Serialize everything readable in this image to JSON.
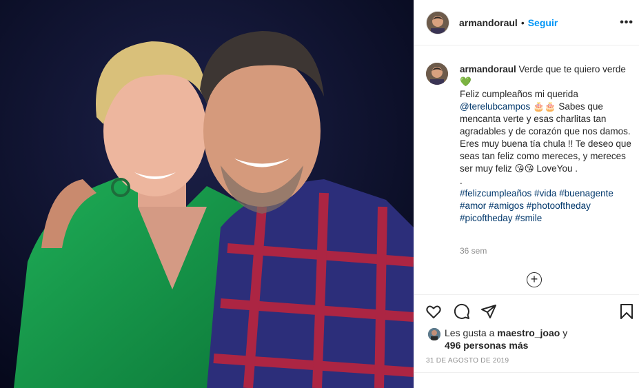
{
  "post": {
    "username": "armandoraul",
    "separator": "•",
    "follow_label": "Seguir",
    "more_icon": "•••"
  },
  "caption": {
    "username": "armandoraul",
    "line1": " Verde que te quiero verde 💚",
    "line2": "Feliz cumpleaños mi querida",
    "mention": "@terelubcampos",
    "line3": " 🎂🎂 Sabes que mencanta verte y esas charlitas tan agradables y de corazón que nos damos. Eres muy buena tía chula !! Te deseo que seas tan feliz como mereces, y mereces ser muy feliz 😘😘 LoveYou .",
    "line4": ".",
    "hashtags": "#felizcumpleaños #vida #buenagente #amor #amigos #photooftheday #picoftheday #smile",
    "time_ago": "36 sem"
  },
  "load_more_label": "+",
  "likes": {
    "prefix": "Les gusta a ",
    "user": "maestro_joao",
    "suffix": " y",
    "others": "496 personas más"
  },
  "date": "31 DE AGOSTO DE 2019",
  "icons": {
    "like": "heart-icon",
    "comment": "comment-icon",
    "share": "share-icon",
    "save": "bookmark-icon"
  },
  "colors": {
    "link_blue": "#0095f6",
    "hashtag": "#00376b",
    "muted": "#8e8e8e"
  }
}
